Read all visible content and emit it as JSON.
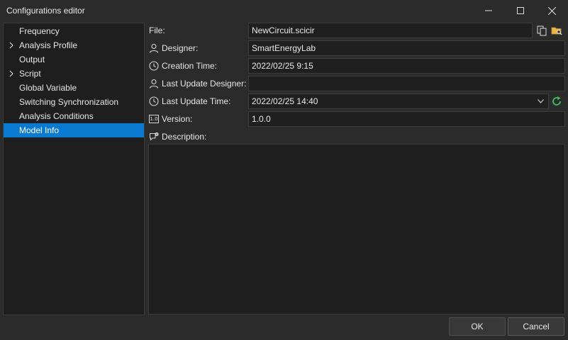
{
  "window": {
    "title": "Configurations editor"
  },
  "sidebar": {
    "items": [
      {
        "label": "Frequency",
        "expandable": false,
        "selected": false
      },
      {
        "label": "Analysis Profile",
        "expandable": true,
        "selected": false
      },
      {
        "label": "Output",
        "expandable": false,
        "selected": false
      },
      {
        "label": "Script",
        "expandable": true,
        "selected": false
      },
      {
        "label": "Global Variable",
        "expandable": false,
        "selected": false
      },
      {
        "label": "Switching Synchronization",
        "expandable": false,
        "selected": false
      },
      {
        "label": "Analysis Conditions",
        "expandable": false,
        "selected": false
      },
      {
        "label": "Model Info",
        "expandable": false,
        "selected": true
      }
    ]
  },
  "form": {
    "file": {
      "label": "File:",
      "value": "NewCircuit.scicir"
    },
    "designer": {
      "label": "Designer:",
      "value": "SmartEnergyLab",
      "icon": "user-icon"
    },
    "creation_time": {
      "label": "Creation Time:",
      "value": "2022/02/25 9:15",
      "icon": "clock-icon"
    },
    "last_update_designer": {
      "label": "Last Update Designer:",
      "value": "",
      "icon": "user-icon"
    },
    "last_update_time": {
      "label": "Last Update Time:",
      "value": "2022/02/25 14:40",
      "icon": "clock-icon"
    },
    "version": {
      "label": "Version:",
      "value": "1.0.0",
      "icon": "version-icon",
      "icon_text": "1.0"
    },
    "description": {
      "label": "Description:",
      "value": "",
      "icon": "comment-info-icon"
    }
  },
  "buttons": {
    "ok": "OK",
    "cancel": "Cancel"
  },
  "colors": {
    "accent": "#0b7ad1",
    "refresh": "#3fbf5f",
    "folder": "#e8b54a"
  }
}
